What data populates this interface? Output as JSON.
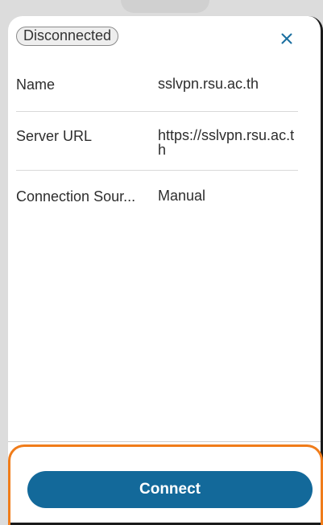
{
  "status": {
    "label": "Disconnected"
  },
  "close_button": {
    "icon": "close-icon",
    "color": "#1a6fa0"
  },
  "details": [
    {
      "label": "Name",
      "value": "sslvpn.rsu.ac.th"
    },
    {
      "label": "Server URL",
      "value": "https://sslvpn.rsu.ac.th"
    },
    {
      "label": "Connection Sour...",
      "value": "Manual"
    }
  ],
  "footer": {
    "connect_label": "Connect"
  },
  "colors": {
    "accent": "#13699a",
    "highlight": "#f07c1a"
  }
}
